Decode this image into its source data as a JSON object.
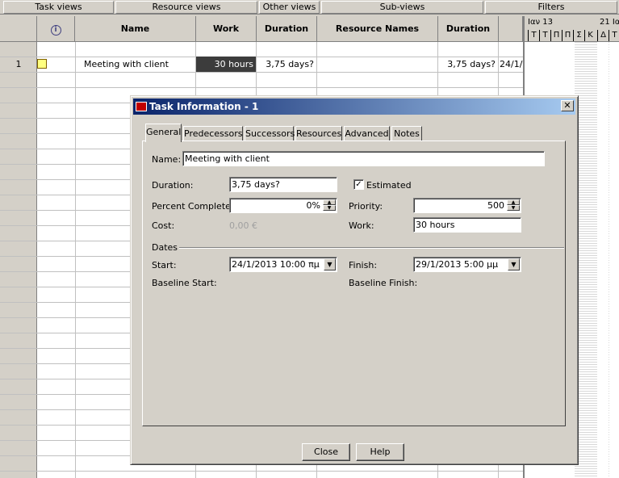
{
  "viewbar": {
    "items": [
      "Task views",
      "Resource views",
      "Other views",
      "Sub-views",
      "Filters"
    ]
  },
  "grid": {
    "headers": {
      "name": "Name",
      "work": "Work",
      "duration": "Duration",
      "resource_names": "Resource Names",
      "duration2": "Duration"
    },
    "row1": {
      "id": "1",
      "name": "Meeting with client",
      "work": "30 hours",
      "duration": "3,75 days?",
      "duration2": "3,75 days?",
      "start_partial": "24/1/"
    }
  },
  "gantt": {
    "week1": "Ιαν 13",
    "week2": "21 Ια",
    "days": [
      "Τ",
      "Τ",
      "Π",
      "Π",
      "Σ",
      "Κ",
      "Δ",
      "Τ"
    ]
  },
  "dialog": {
    "title": "Task Information - 1",
    "close_glyph": "✕",
    "tabs": [
      "General",
      "Predecessors",
      "Successors",
      "Resources",
      "Advanced",
      "Notes"
    ],
    "name_label": "Name:",
    "name_value": "Meeting with client",
    "duration_label": "Duration:",
    "duration_value": "3,75 days?",
    "estimated_label": "Estimated",
    "estimated_checked": "✓",
    "percent_label": "Percent Complete:",
    "percent_value": "0%",
    "priority_label": "Priority:",
    "priority_value": "500",
    "cost_label": "Cost:",
    "cost_value": "0,00 €",
    "work_label": "Work:",
    "work_value": "30 hours",
    "dates_label": "Dates",
    "start_label": "Start:",
    "start_value": "24/1/2013 10:00 πμ",
    "finish_label": "Finish:",
    "finish_value": "29/1/2013 5:00 μμ",
    "baseline_start_label": "Baseline Start:",
    "baseline_finish_label": "Baseline Finish:",
    "close_button": "Close",
    "help_button": "Help"
  }
}
